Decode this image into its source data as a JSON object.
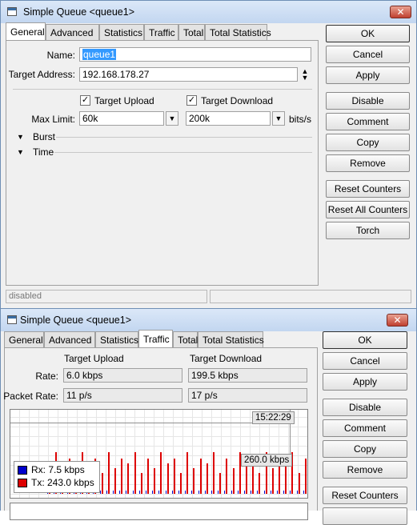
{
  "window1": {
    "title": "Simple Queue <queue1>",
    "close_glyph": "✕",
    "tabs": [
      "General",
      "Advanced",
      "Statistics",
      "Traffic",
      "Total",
      "Total Statistics"
    ],
    "active_tab": "General",
    "name_label": "Name:",
    "name_value": "queue1",
    "target_address_label": "Target Address:",
    "target_address_value": "192.168.178.27",
    "target_upload_label": "Target Upload",
    "target_upload_checked": true,
    "target_download_label": "Target Download",
    "target_download_checked": true,
    "max_limit_label": "Max Limit:",
    "max_limit_upload": "60k",
    "max_limit_download": "200k",
    "unit": "bits/s",
    "burst_label": "Burst",
    "time_label": "Time",
    "status": "disabled",
    "buttons": [
      "OK",
      "Cancel",
      "Apply",
      "Disable",
      "Comment",
      "Copy",
      "Remove",
      "Reset Counters",
      "Reset All Counters",
      "Torch"
    ]
  },
  "window2": {
    "title": "Simple Queue <queue1>",
    "close_glyph": "✕",
    "tabs": [
      "General",
      "Advanced",
      "Statistics",
      "Traffic",
      "Total",
      "Total Statistics"
    ],
    "active_tab": "Traffic",
    "col_upload": "Target Upload",
    "col_download": "Target Download",
    "rate_label": "Rate:",
    "rate_upload": "6.0 kbps",
    "rate_download": "199.5 kbps",
    "packet_rate_label": "Packet Rate:",
    "packet_rate_upload": "11 p/s",
    "packet_rate_download": "17 p/s",
    "graph_time": "15:22:29",
    "graph_max": "260.0 kbps",
    "legend_rx": "Rx:  7.5 kbps",
    "legend_tx": "Tx:  243.0 kbps",
    "rx_color": "#0000cc",
    "tx_color": "#dd0000",
    "buttons": [
      "OK",
      "Cancel",
      "Apply",
      "Disable",
      "Comment",
      "Copy",
      "Remove",
      "Reset Counters"
    ]
  }
}
